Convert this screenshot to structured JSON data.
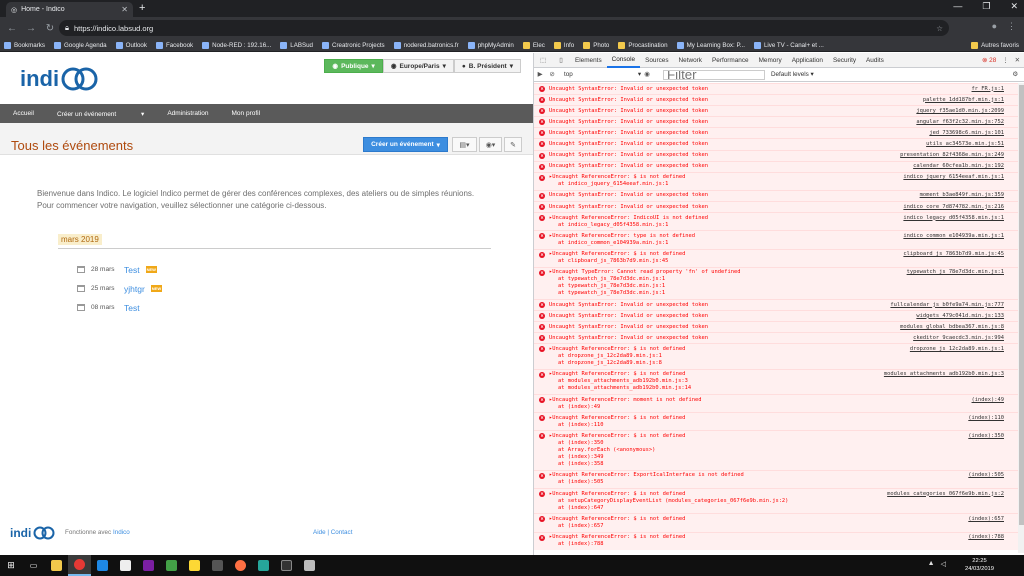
{
  "browser": {
    "tab_title": "Home - Indico",
    "url": "https://indico.labsud.org",
    "bookmarks": [
      "Bookmarks",
      "Google Agenda",
      "Outlook",
      "Facebook",
      "Node-RED : 192.16...",
      "LABSud",
      "Creatronic Projects",
      "nodered.batronics.fr",
      "phpMyAdmin",
      "Elec",
      "Info",
      "Photo",
      "Procastination",
      "My Learning Box: P...",
      "Live TV - Canal+ et ..."
    ],
    "other_bookmarks": "Autres favoris"
  },
  "indico": {
    "pills": {
      "public": "Publique",
      "timezone": "Europe/Paris",
      "user": "B. Président"
    },
    "nav": [
      "Accueil",
      "Créer un événement",
      "Administration",
      "Mon profil"
    ],
    "page_title": "Tous les événements",
    "create_button": "Créer un événement",
    "welcome_line1": "Bienvenue dans Indico. Le logiciel Indico permet de gérer des conférences complexes, des ateliers ou de simples réunions.",
    "welcome_line2": "Pour commencer votre navigation, veuillez sélectionner une catégorie ci-dessous.",
    "month": "mars 2019",
    "events": [
      {
        "date": "28 mars",
        "name": "Test",
        "badge": "NEW"
      },
      {
        "date": "25 mars",
        "name": "yjhtgr",
        "badge": "NEW"
      },
      {
        "date": "08 mars",
        "name": "Test",
        "badge": ""
      }
    ],
    "footer_text": "Fonctionne avec",
    "footer_link": "Indico",
    "footer_links": "Aide | Contact"
  },
  "devtools": {
    "tabs": [
      "Elements",
      "Console",
      "Sources",
      "Network",
      "Performance",
      "Memory",
      "Application",
      "Security",
      "Audits"
    ],
    "active_tab": "Console",
    "error_count": "28",
    "context": "top",
    "filter_placeholder": "Filter",
    "levels": "Default levels",
    "messages": [
      {
        "text": "Uncaught SyntaxError: Invalid or unexpected token",
        "src": "fr_FR.js:1",
        "trace": []
      },
      {
        "text": "Uncaught SyntaxError: Invalid or unexpected token",
        "src": "palette_1dd187bf.min.js:1",
        "trace": []
      },
      {
        "text": "Uncaught SyntaxError: Invalid or unexpected token",
        "src": "jquery_f35ae1d0.min.js:2099",
        "trace": []
      },
      {
        "text": "Uncaught SyntaxError: Invalid or unexpected token",
        "src": "angular_f63f2c32.min.js:752",
        "trace": []
      },
      {
        "text": "Uncaught SyntaxError: Invalid or unexpected token",
        "src": "jed_733698c6.min.js:101",
        "trace": []
      },
      {
        "text": "Uncaught SyntaxError: Invalid or unexpected token",
        "src": "utils_ac34573e.min.js:51",
        "trace": []
      },
      {
        "text": "Uncaught SyntaxError: Invalid or unexpected token",
        "src": "presentation_82f4368e.min.js:249",
        "trace": []
      },
      {
        "text": "Uncaught SyntaxError: Invalid or unexpected token",
        "src": "calendar_60cfea1b.min.js:192",
        "trace": []
      },
      {
        "text": "▸Uncaught ReferenceError: $ is not defined",
        "src": "indico_jquery_6154eeaf.min.js:1",
        "trace": [
          "at indico_jquery_6154eeaf.min.js:1"
        ]
      },
      {
        "text": "Uncaught SyntaxError: Invalid or unexpected token",
        "src": "moment_b3ae849f.min.js:359",
        "trace": []
      },
      {
        "text": "Uncaught SyntaxError: Invalid or unexpected token",
        "src": "indico_core_7d874782.min.js:216",
        "trace": []
      },
      {
        "text": "▸Uncaught ReferenceError: IndicoUI is not defined",
        "src": "indico_legacy_d05f4358.min.js:1",
        "trace": [
          "at indico_legacy_d05f4358.min.js:1"
        ]
      },
      {
        "text": "▸Uncaught ReferenceError: type is not defined",
        "src": "indico_common_e104939a.min.js:1",
        "trace": [
          "at indico_common_e104939a.min.js:1"
        ]
      },
      {
        "text": "▸Uncaught ReferenceError: $ is not defined",
        "src": "clipboard_js_7863b7d9.min.js:45",
        "trace": [
          "at clipboard_js_7863b7d9.min.js:45"
        ]
      },
      {
        "text": "▸Uncaught TypeError: Cannot read property 'fn' of undefined",
        "src": "typewatch_js_78e7d3dc.min.js:1",
        "trace": [
          "at typewatch_js_78e7d3dc.min.js:1",
          "at typewatch_js_78e7d3dc.min.js:1",
          "at typewatch_js_78e7d3dc.min.js:1"
        ]
      },
      {
        "text": "Uncaught SyntaxError: Invalid or unexpected token",
        "src": "fullcalendar_js_b0fe9a74.min.js:777",
        "trace": []
      },
      {
        "text": "Uncaught SyntaxError: Invalid or unexpected token",
        "src": "widgets_479c041d.min.js:133",
        "trace": []
      },
      {
        "text": "Uncaught SyntaxError: Invalid or unexpected token",
        "src": "modules_global_bdbea367.min.js:8",
        "trace": []
      },
      {
        "text": "Uncaught SyntaxError: Invalid or unexpected token",
        "src": "ckeditor_9caecdc3.min.js:994",
        "trace": []
      },
      {
        "text": "▸Uncaught ReferenceError: $ is not defined",
        "src": "dropzone_js_12c2da89.min.js:1",
        "trace": [
          "at dropzone_js_12c2da89.min.js:1",
          "at dropzone_js_12c2da89.min.js:8"
        ]
      },
      {
        "text": "▸Uncaught ReferenceError: $ is not defined",
        "src": "modules_attachments_adb192b0.min.js:3",
        "trace": [
          "at modules_attachments_adb192b0.min.js:3",
          "at modules_attachments_adb192b0.min.js:14"
        ]
      },
      {
        "text": "▸Uncaught ReferenceError: moment is not defined",
        "src": "(index):49",
        "trace": [
          "at (index):49"
        ]
      },
      {
        "text": "▸Uncaught ReferenceError: $ is not defined",
        "src": "(index):110",
        "trace": [
          "at (index):110"
        ]
      },
      {
        "text": "▸Uncaught ReferenceError: $ is not defined",
        "src": "(index):350",
        "trace": [
          "at (index):350",
          "at Array.forEach (<anonymous>)",
          "at (index):349",
          "at (index):358"
        ]
      },
      {
        "text": "▸Uncaught ReferenceError: ExportIcalInterface is not defined",
        "src": "(index):505",
        "trace": [
          "at (index):505"
        ]
      },
      {
        "text": "▸Uncaught ReferenceError: $ is not defined",
        "src": "modules_categories_067f6e9b.min.js:2",
        "trace": [
          "at setupCategoryDisplayEventList (modules_categories_067f6e9b.min.js:2)",
          "at (index):647"
        ]
      },
      {
        "text": "▸Uncaught ReferenceError: $ is not defined",
        "src": "(index):657",
        "trace": [
          "at (index):657"
        ]
      },
      {
        "text": "▸Uncaught ReferenceError: $ is not defined",
        "src": "(index):788",
        "trace": [
          "at (index):788"
        ]
      }
    ]
  },
  "taskbar": {
    "time": "22:25",
    "date": "24/03/2019"
  },
  "colors": {
    "indico_blue": "#1a64a8",
    "green": "#5cb85c",
    "accent": "#3d8ee0",
    "title": "#af4a0e"
  }
}
